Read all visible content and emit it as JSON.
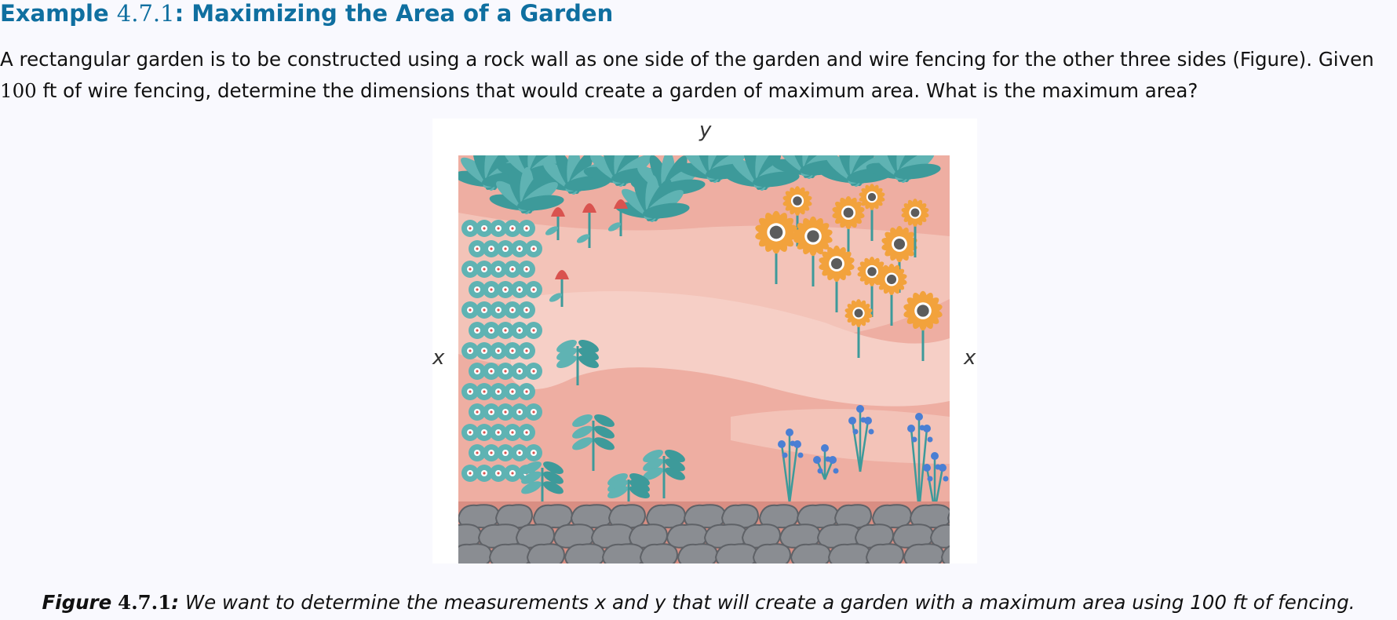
{
  "example": {
    "prefix": "Example ",
    "number": "4.7.1",
    "title": ": Maximizing the Area of a Garden"
  },
  "problem": {
    "part1": "A rectangular garden is to be constructed using a rock wall as one side of the garden and wire fencing for the other three sides (Figure). Given ",
    "quantity": "100",
    "part2": " ft of wire fencing, determine the dimensions that would create a garden of maximum area. What is the maximum area?"
  },
  "figure": {
    "label_top": "y",
    "label_left": "x",
    "label_right": "x",
    "colors": {
      "ground": "#eeaea2",
      "path": "#f6cfc6",
      "foliage": "#5fb3b3",
      "foliage_dark": "#3d9a9a",
      "sunflower": "#f2a23c",
      "sunflower_center": "#5c5c5c",
      "tulip": "#d9534f",
      "bluebell": "#4a7fd4",
      "rock": "#8a8d92",
      "rock_dark": "#5f6267"
    }
  },
  "caption": {
    "label": "Figure",
    "number": "4.7.1",
    "colon": ":",
    "text": " We want to determine the measurements x and y that will create a garden with a maximum area using 100 ft of fencing."
  }
}
